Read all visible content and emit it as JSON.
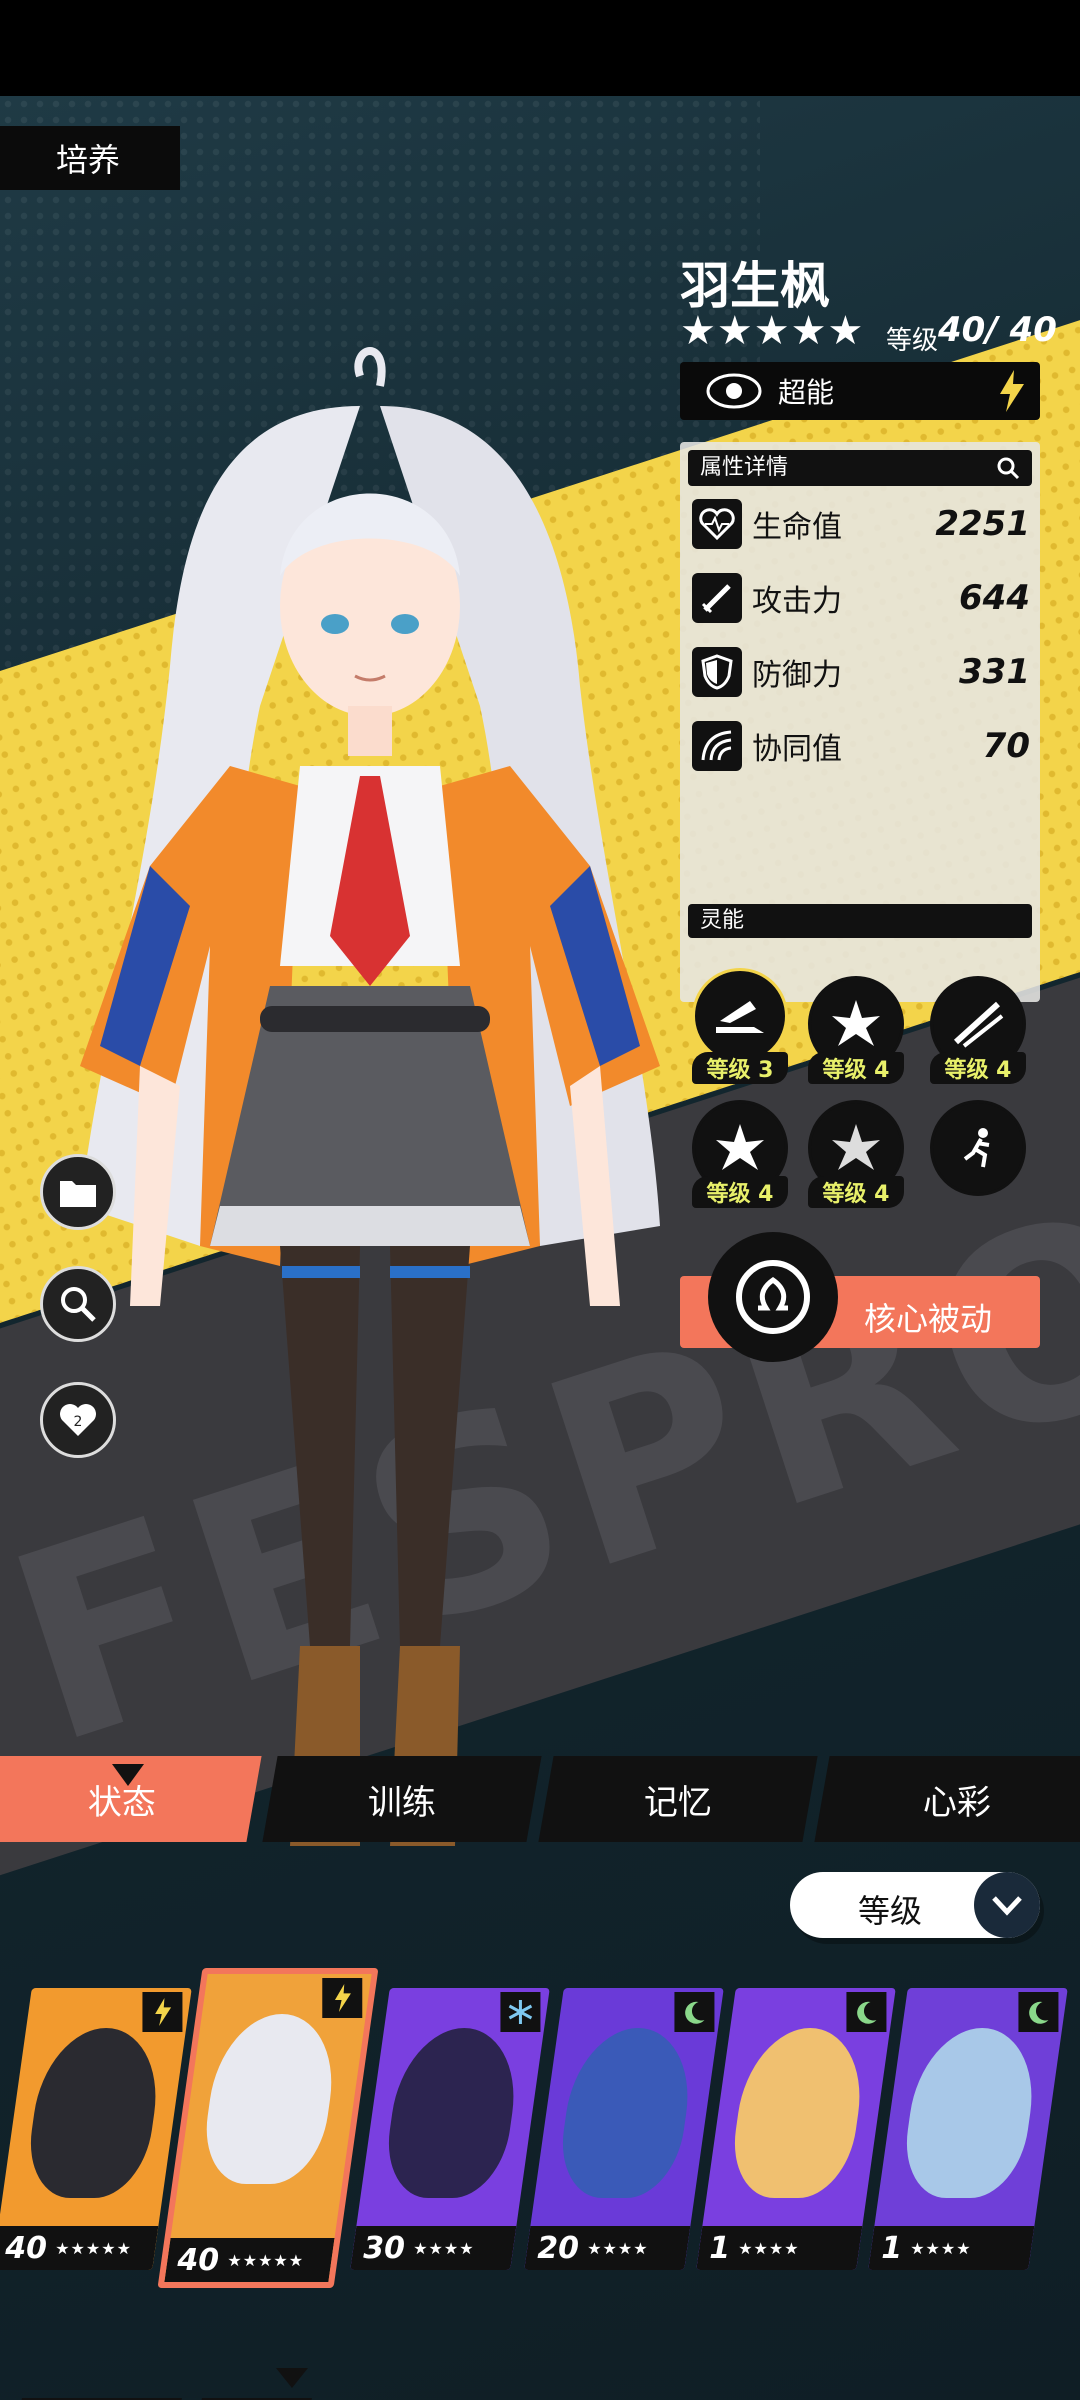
{
  "header": {
    "section": "培养"
  },
  "character": {
    "name": "羽生枫",
    "stars": "★★★★★",
    "level_label": "等级",
    "level_value": "40/ 40",
    "type_label": "超能"
  },
  "attributes": {
    "title": "属性详情",
    "rows": [
      {
        "name": "生命值",
        "value": "2251",
        "icon": "heart-pulse-icon"
      },
      {
        "name": "攻击力",
        "value": "644",
        "icon": "sword-icon"
      },
      {
        "name": "防御力",
        "value": "331",
        "icon": "shield-icon"
      },
      {
        "name": "协同值",
        "value": "70",
        "icon": "swirl-icon"
      }
    ]
  },
  "psychic": {
    "title": "灵能",
    "skills": [
      {
        "level": "等级 3",
        "active": true
      },
      {
        "level": "等级 4",
        "active": false
      },
      {
        "level": "等级 4",
        "active": false
      },
      {
        "level": "等级 4",
        "active": false
      },
      {
        "level": "等级 4",
        "active": false
      },
      {
        "level": "",
        "active": false
      }
    ]
  },
  "core_passive": {
    "label": "核心被动"
  },
  "tabs": [
    "状态",
    "训练",
    "记忆",
    "心彩"
  ],
  "sort": {
    "label": "等级"
  },
  "big_text": "FESPROF",
  "roster": [
    {
      "level": "40",
      "stars": "★★★★★",
      "element": "bolt-icon",
      "bg": "#f29a2e"
    },
    {
      "level": "40",
      "stars": "★★★★★",
      "element": "bolt-icon",
      "bg": "#f0a23a",
      "selected": true
    },
    {
      "level": "30",
      "stars": "★★★★",
      "element": "snowflake-icon",
      "bg": "#7a3fe0"
    },
    {
      "level": "20",
      "stars": "★★★★",
      "element": "crescent-icon",
      "bg": "#6a3ad8"
    },
    {
      "level": "1",
      "stars": "★★★★",
      "element": "crescent-icon",
      "bg": "#7a3fe0"
    },
    {
      "level": "1",
      "stars": "★★★★",
      "element": "crescent-icon",
      "bg": "#6f3fd8"
    }
  ],
  "colors": {
    "accent": "#f3765b",
    "yellow": "#f3d44a",
    "purple": "#7a3fe0",
    "dark": "#111111"
  }
}
